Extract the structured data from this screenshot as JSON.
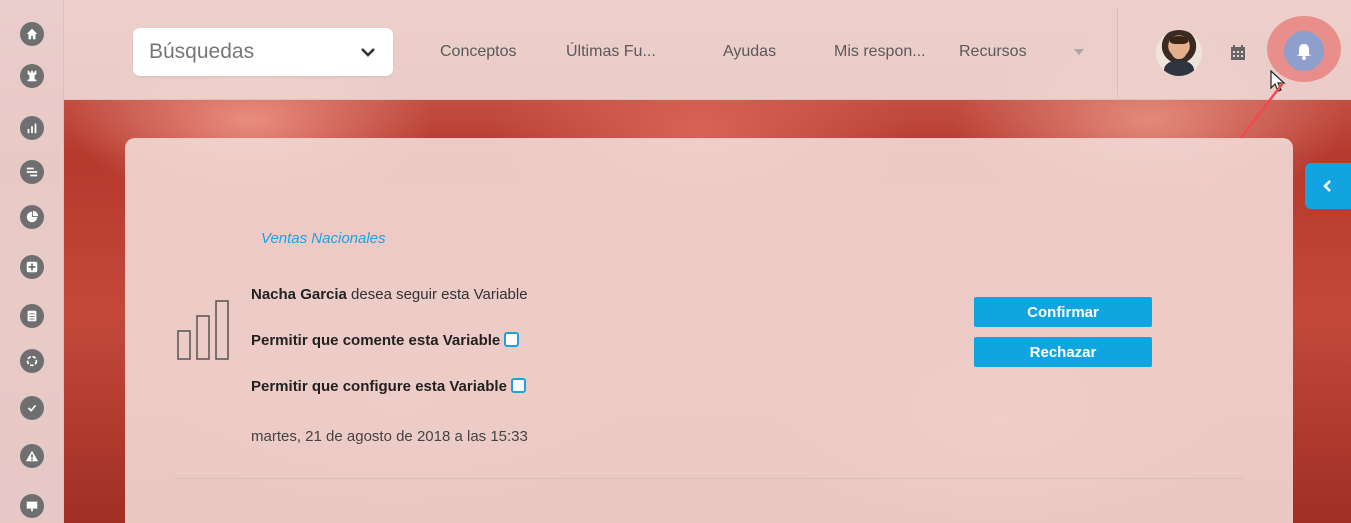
{
  "sidebar": {
    "icons": [
      "home-icon",
      "rook-icon",
      "bar-chart-icon",
      "list-icon",
      "pie-chart-icon",
      "plus-square-icon",
      "document-icon",
      "circle-dashed-icon",
      "check-circle-icon",
      "warning-icon",
      "presentation-icon"
    ]
  },
  "header": {
    "search_label": "Búsquedas",
    "nav": [
      "Conceptos",
      "Últimas Fu...",
      "Ayudas",
      "Mis respon...",
      "Recursos"
    ]
  },
  "notification": {
    "variable_name": "Ventas Nacionales",
    "requester": "Nacha Garcia",
    "request_text": " desea seguir esta Variable",
    "permission_comment": "Permitir que comente esta Variable",
    "permission_configure": "Permitir que configure esta Variable",
    "timestamp": "martes, 21 de agosto de 2018 a las 15:33",
    "confirm_label": "Confirmar",
    "reject_label": "Rechazar"
  },
  "colors": {
    "accent": "#1ca3dd",
    "button": "#0fa5e0",
    "highlight": "#e77876",
    "arrow": "#ee4b4b"
  }
}
